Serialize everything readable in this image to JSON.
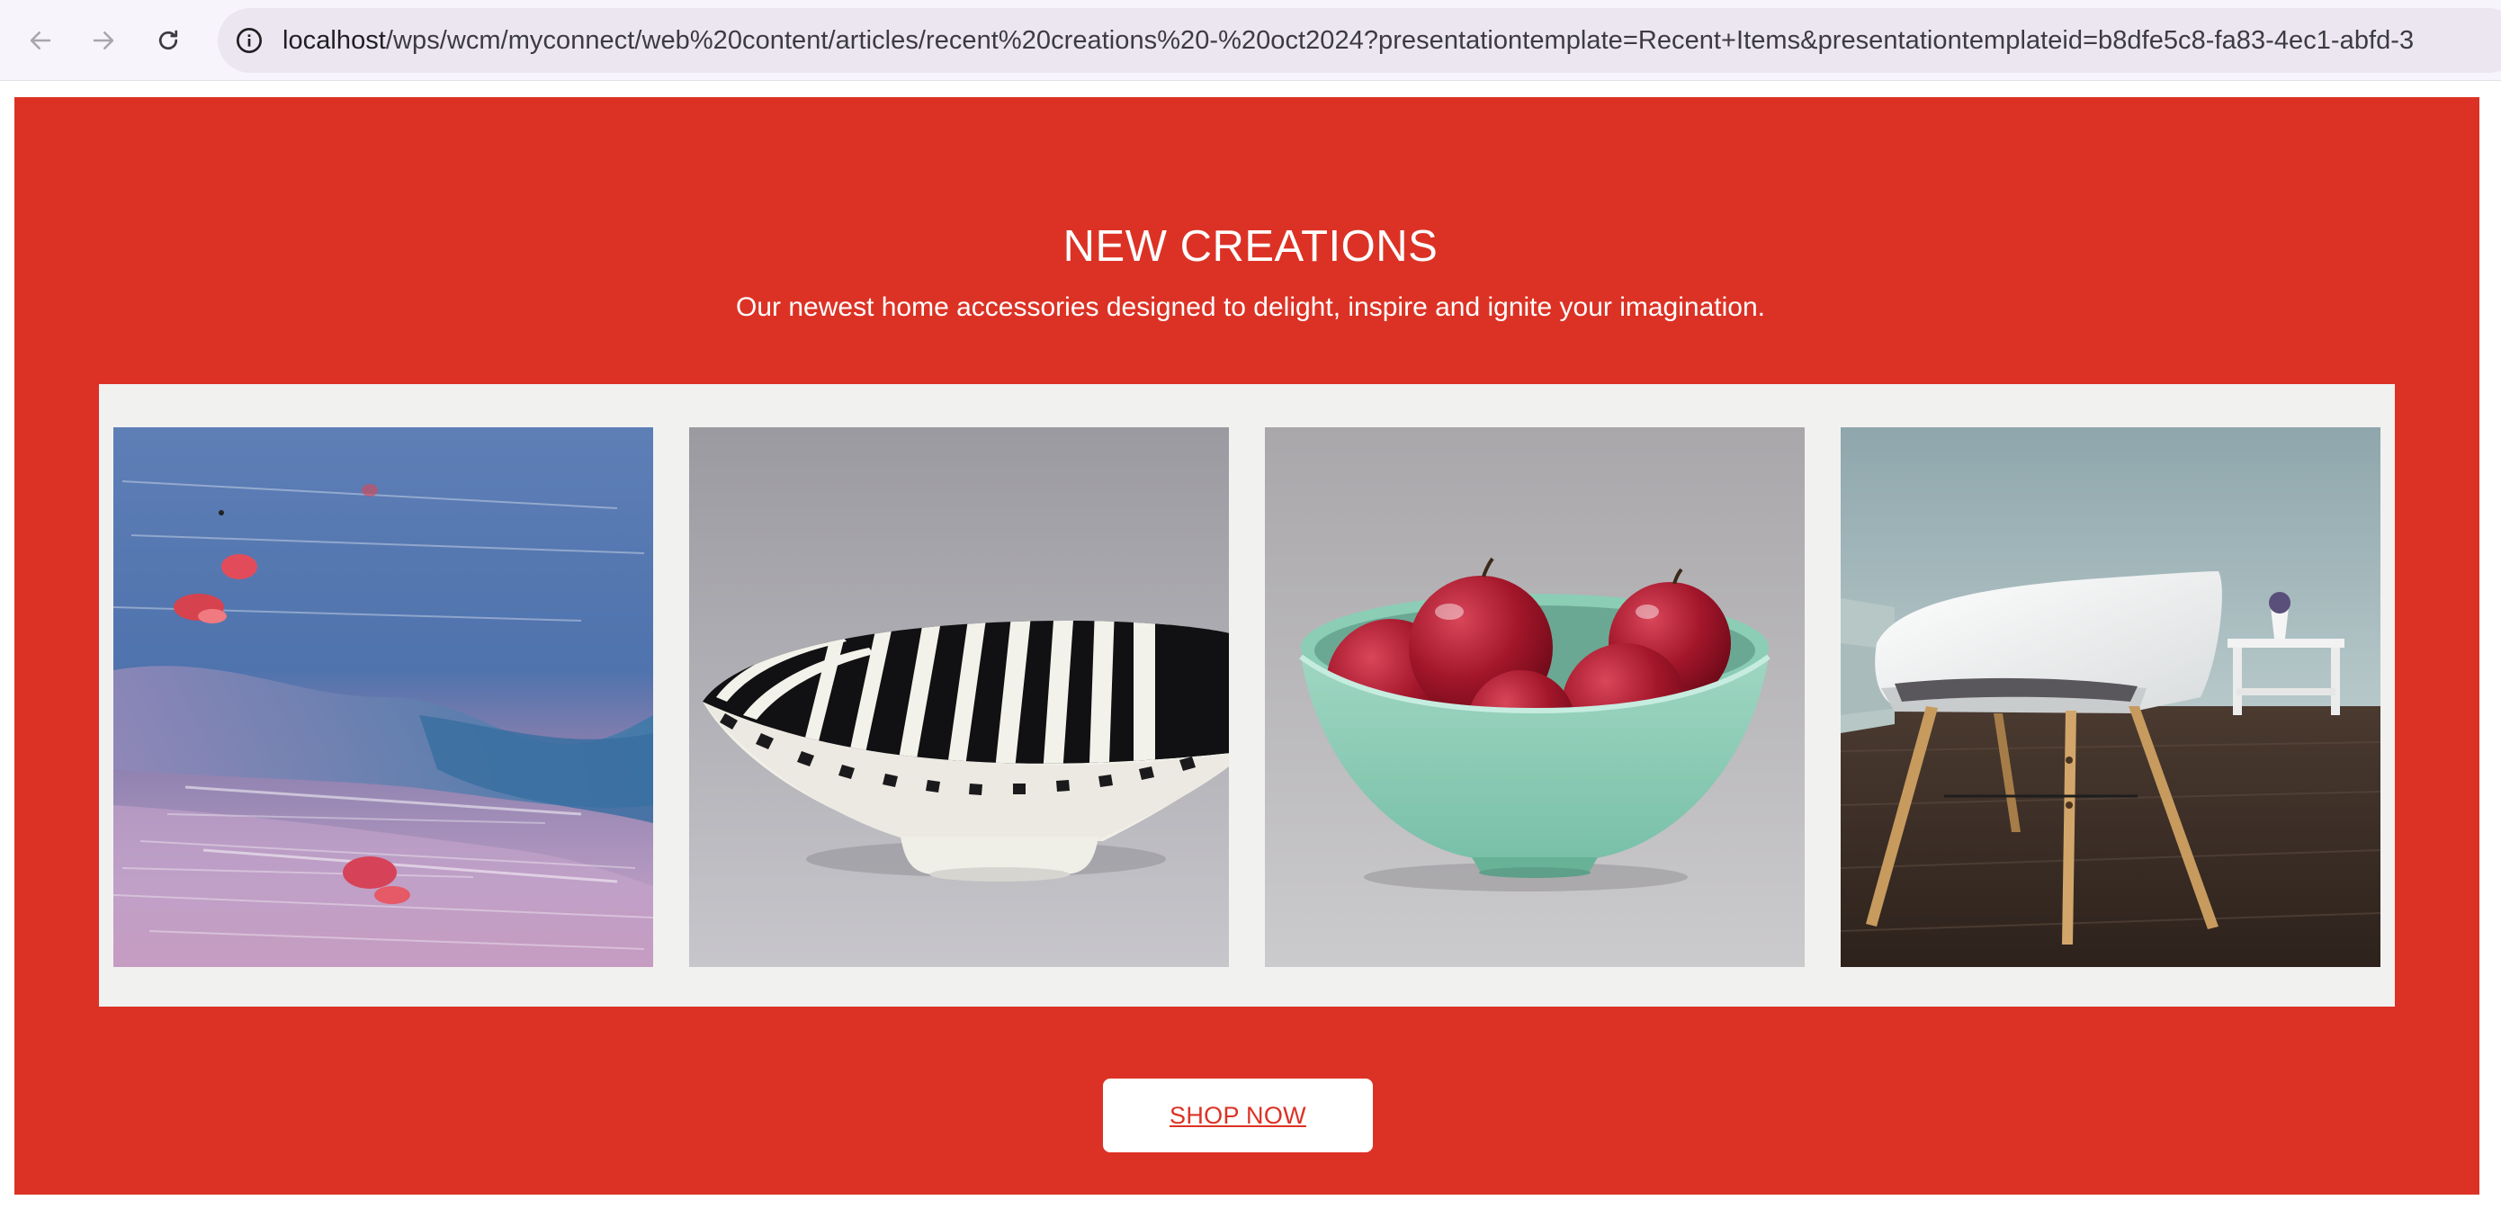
{
  "browser": {
    "url_host": "localhost",
    "url_path": "/wps/wcm/myconnect/web%20content/articles/recent%20creations%20-%20oct2024?presentationtemplate=Recent+Items&presentationtemplateid=b8dfe5c8-fa83-4ec1-abfd-3",
    "icons": [
      "back-arrow-icon",
      "forward-arrow-icon",
      "reload-icon",
      "site-info-icon"
    ]
  },
  "banner": {
    "title": "NEW CREATIONS",
    "subtitle": "Our newest home accessories designed to delight, inspire and ignite your imagination.",
    "background_color": "#dc3225",
    "gallery_background": "#f1f1f0"
  },
  "gallery": {
    "items": [
      {
        "name": "abstract-painting-image"
      },
      {
        "name": "striped-bowl-image"
      },
      {
        "name": "apple-bowl-image"
      },
      {
        "name": "white-chair-image"
      }
    ]
  },
  "cta": {
    "label": "SHOP NOW",
    "text_color": "#dc3225"
  }
}
